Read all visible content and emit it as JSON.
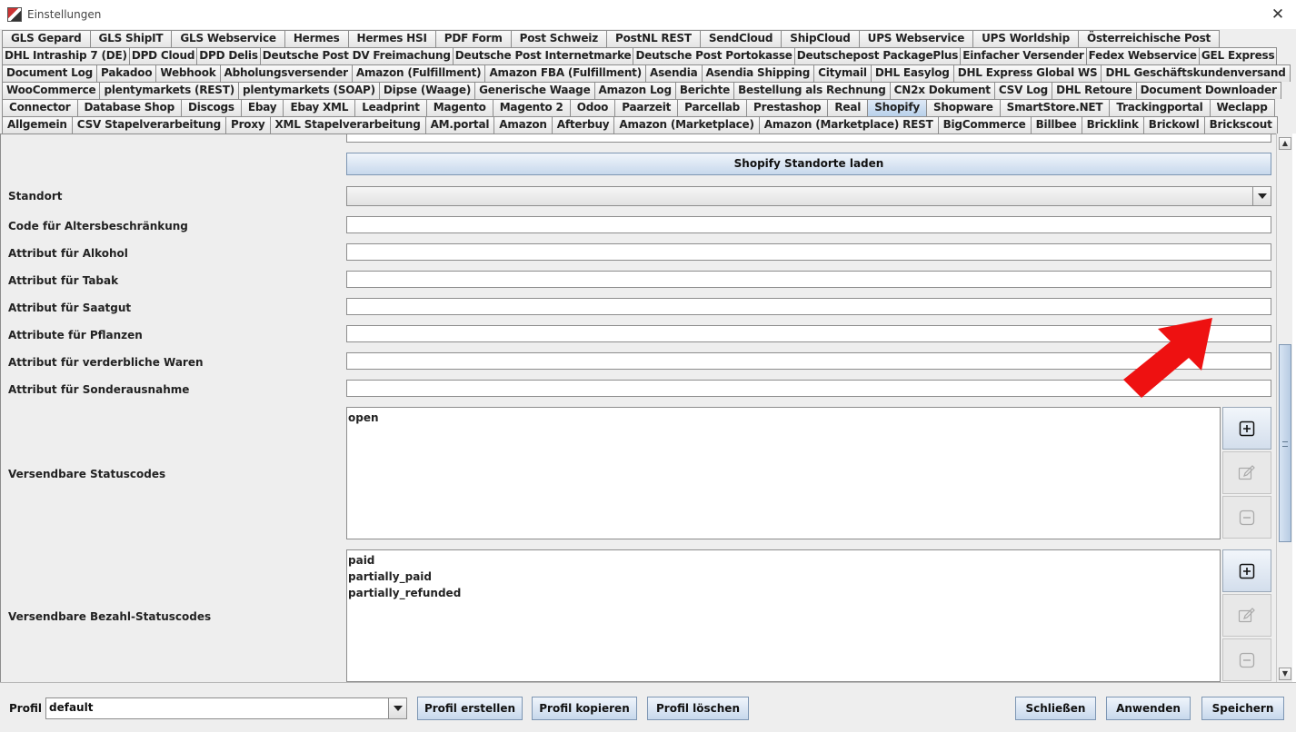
{
  "window": {
    "title": "Einstellungen",
    "close_glyph": "✕"
  },
  "tabs": {
    "row1": [
      "GLS Gepard",
      "GLS ShipIT",
      "GLS Webservice",
      "Hermes",
      "Hermes HSI",
      "PDF Form",
      "Post Schweiz",
      "PostNL REST",
      "SendCloud",
      "ShipCloud",
      "UPS Webservice",
      "UPS Worldship",
      "Österreichische Post"
    ],
    "row2": [
      "DHL Intraship 7 (DE)",
      "DPD Cloud",
      "DPD Delis",
      "Deutsche Post DV Freimachung",
      "Deutsche Post Internetmarke",
      "Deutsche Post Portokasse",
      "Deutschepost PackagePlus",
      "Einfacher Versender",
      "Fedex Webservice",
      "GEL Express"
    ],
    "row3": [
      "Document Log",
      "Pakadoo",
      "Webhook",
      "Abholungsversender",
      "Amazon (Fulfillment)",
      "Amazon FBA (Fulfillment)",
      "Asendia",
      "Asendia Shipping",
      "Citymail",
      "DHL Easylog",
      "DHL Express Global WS",
      "DHL Geschäftskundenversand"
    ],
    "row4": [
      "WooCommerce",
      "plentymarkets (REST)",
      "plentymarkets (SOAP)",
      "Dipse (Waage)",
      "Generische Waage",
      "Amazon Log",
      "Berichte",
      "Bestellung als Rechnung",
      "CN2x Dokument",
      "CSV Log",
      "DHL Retoure",
      "Document Downloader"
    ],
    "row5": [
      "Connector",
      "Database Shop",
      "Discogs",
      "Ebay",
      "Ebay XML",
      "Leadprint",
      "Magento",
      "Magento 2",
      "Odoo",
      "Paarzeit",
      "Parcellab",
      "Prestashop",
      "Real",
      "Shopify",
      "Shopware",
      "SmartStore.NET",
      "Trackingportal",
      "Weclapp"
    ],
    "row6": [
      "Allgemein",
      "CSV Stapelverarbeitung",
      "Proxy",
      "XML Stapelverarbeitung",
      "AM.portal",
      "Amazon",
      "Afterbuy",
      "Amazon (Marketplace)",
      "Amazon (Marketplace) REST",
      "BigCommerce",
      "Billbee",
      "Bricklink",
      "Brickowl",
      "Brickscout"
    ],
    "active": "Shopify"
  },
  "form": {
    "load_locations_button": "Shopify Standorte laden",
    "labels": {
      "standort": "Standort",
      "age_code": "Code für Altersbeschränkung",
      "alcohol": "Attribut für Alkohol",
      "tobacco": "Attribut für Tabak",
      "seeds": "Attribut für Saatgut",
      "plants": "Attribute für Pflanzen",
      "perishable": "Attribut für verderbliche Waren",
      "exception": "Attribut für Sonderausnahme",
      "status_codes": "Versendbare Statuscodes",
      "payment_status_codes": "Versendbare Bezahl-Statuscodes"
    },
    "values": {
      "standort": "",
      "age_code": "",
      "alcohol": "",
      "tobacco": "",
      "seeds": "",
      "plants": "",
      "perishable": "",
      "exception": ""
    },
    "status_codes": [
      "open"
    ],
    "payment_status_codes": [
      "paid",
      "partially_paid",
      "partially_refunded"
    ]
  },
  "footer": {
    "profile_label": "Profil",
    "profile_value": "default",
    "create_profile": "Profil erstellen",
    "copy_profile": "Profil kopieren",
    "delete_profile": "Profil löschen",
    "close": "Schließen",
    "apply": "Anwenden",
    "save": "Speichern"
  },
  "colors": {
    "annotation_arrow": "#ee1111",
    "active_tab": "#c5d8ee"
  }
}
